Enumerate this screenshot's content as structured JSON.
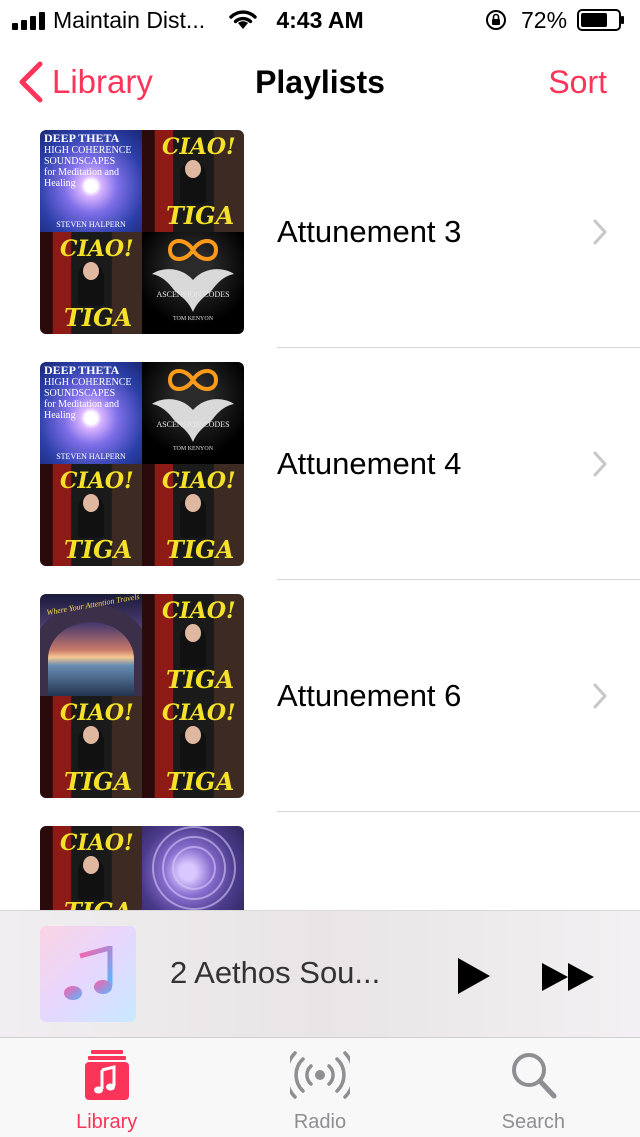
{
  "status_bar": {
    "carrier": "Maintain Dist...",
    "time": "4:43 AM",
    "battery_percent": "72%",
    "battery_level": 0.72
  },
  "nav": {
    "back_label": "Library",
    "title": "Playlists",
    "sort_label": "Sort"
  },
  "playlists": [
    {
      "name": "Attunement 3"
    },
    {
      "name": "Attunement 4"
    },
    {
      "name": "Attunement 6"
    },
    {
      "name": ""
    }
  ],
  "artwork_text": {
    "theta_title": "DEEP THETA",
    "theta_subtitle": "HIGH COHERENCE SOUNDSCAPES",
    "theta_tagline": "for Meditation and Healing",
    "theta_artist": "STEVEN HALPERN",
    "ciao_top": "CIAO!",
    "ciao_bottom": "TIGA",
    "ascension_title": "ASCENSION CODES",
    "ascension_artist": "TOM KENYON",
    "cave_title": "Where Your Attention Travels"
  },
  "mini_player": {
    "song": "2 Aethos Sou...",
    "play_icon": "play-icon",
    "forward_icon": "fast-forward-icon"
  },
  "tabs": [
    {
      "label": "Library",
      "icon": "library-icon",
      "active": true
    },
    {
      "label": "Radio",
      "icon": "radio-icon",
      "active": false
    },
    {
      "label": "Search",
      "icon": "search-icon",
      "active": false
    }
  ],
  "colors": {
    "accent": "#fb3459",
    "inactive": "#8e8e93"
  }
}
